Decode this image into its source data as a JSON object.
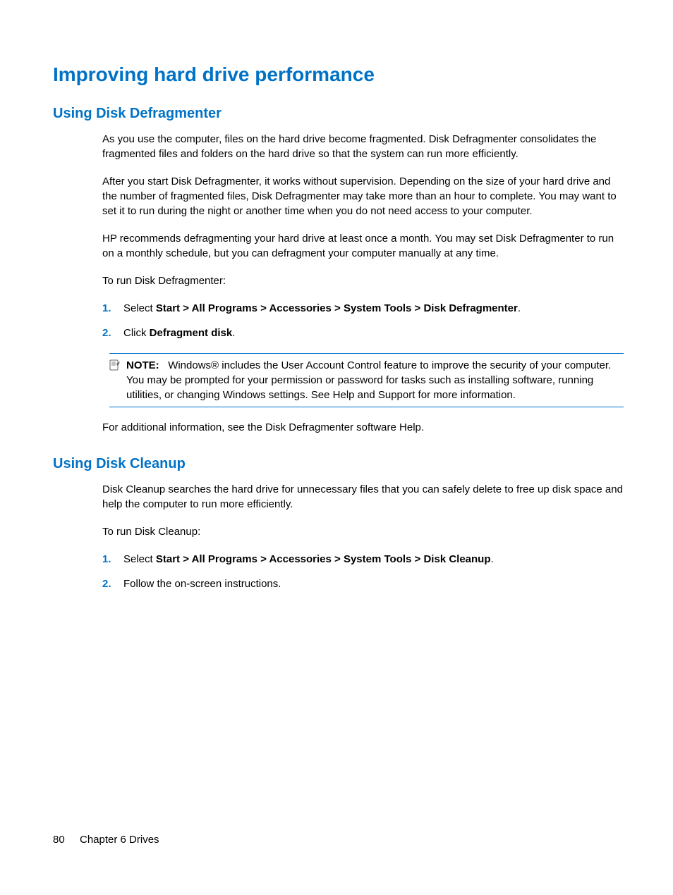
{
  "heading_main": "Improving hard drive performance",
  "section1": {
    "heading": "Using Disk Defragmenter",
    "p1": "As you use the computer, files on the hard drive become fragmented. Disk Defragmenter consolidates the fragmented files and folders on the hard drive so that the system can run more efficiently.",
    "p2": "After you start Disk Defragmenter, it works without supervision. Depending on the size of your hard drive and the number of fragmented files, Disk Defragmenter may take more than an hour to complete. You may want to set it to run during the night or another time when you do not need access to your computer.",
    "p3": "HP recommends defragmenting your hard drive at least once a month. You may set Disk Defragmenter to run on a monthly schedule, but you can defragment your computer manually at any time.",
    "p4": "To run Disk Defragmenter:",
    "list": [
      {
        "num": "1.",
        "prefix": "Select ",
        "bold": "Start > All Programs > Accessories > System Tools > Disk Defragmenter",
        "suffix": "."
      },
      {
        "num": "2.",
        "prefix": "Click ",
        "bold": "Defragment disk",
        "suffix": "."
      }
    ],
    "note": {
      "label": "NOTE:",
      "text": "Windows® includes the User Account Control feature to improve the security of your computer. You may be prompted for your permission or password for tasks such as installing software, running utilities, or changing Windows settings. See Help and Support for more information."
    },
    "p5": "For additional information, see the Disk Defragmenter software Help."
  },
  "section2": {
    "heading": "Using Disk Cleanup",
    "p1": "Disk Cleanup searches the hard drive for unnecessary files that you can safely delete to free up disk space and help the computer to run more efficiently.",
    "p2": "To run Disk Cleanup:",
    "list": [
      {
        "num": "1.",
        "prefix": "Select ",
        "bold": "Start > All Programs > Accessories > System Tools > Disk Cleanup",
        "suffix": "."
      },
      {
        "num": "2.",
        "prefix": "Follow the on-screen instructions.",
        "bold": "",
        "suffix": ""
      }
    ]
  },
  "footer": {
    "page_number": "80",
    "chapter": "Chapter 6   Drives"
  }
}
